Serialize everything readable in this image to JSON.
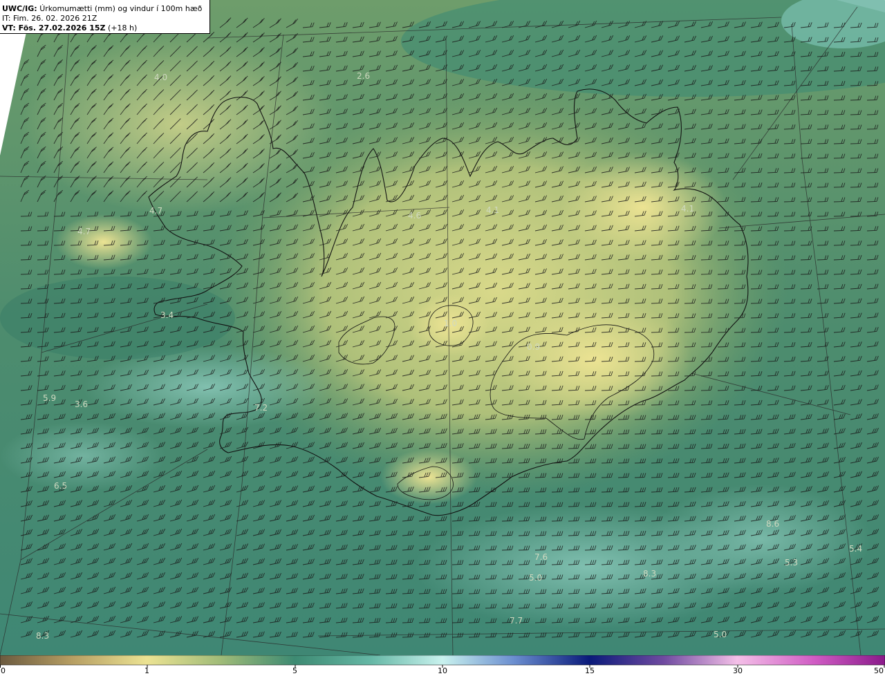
{
  "header": {
    "model": "UWC/IG:",
    "title": "Úrkomumætti (mm) og vindur í 100m hæð",
    "init_time": "IT: Fim. 26. 02. 2026 21Z",
    "valid_label": "VT: Fös. 27.02.2026 15Z",
    "lead": "(+18 h)"
  },
  "colorbar": {
    "ticks": [
      "0",
      "1",
      "5",
      "10",
      "15",
      "30",
      "50"
    ]
  },
  "value_labels": [
    "4.0",
    "2.6",
    "4.7",
    "4.7",
    "4.6",
    "4.1",
    "4.1",
    "3.4",
    "1.0",
    "0.9",
    "5.9",
    "3.6",
    "7.2",
    "6.5",
    "8.6",
    "7.6",
    "5.0",
    "8.3",
    "5.3",
    "5.4",
    "7.7",
    "5.0",
    "8.3"
  ],
  "colors": {
    "dark_teal": "#2f7a68",
    "mid_green": "#6e9a5e",
    "light_yellow": "#e6df8e",
    "pale_cyan": "#8fcfc4",
    "coast": "#111111"
  }
}
